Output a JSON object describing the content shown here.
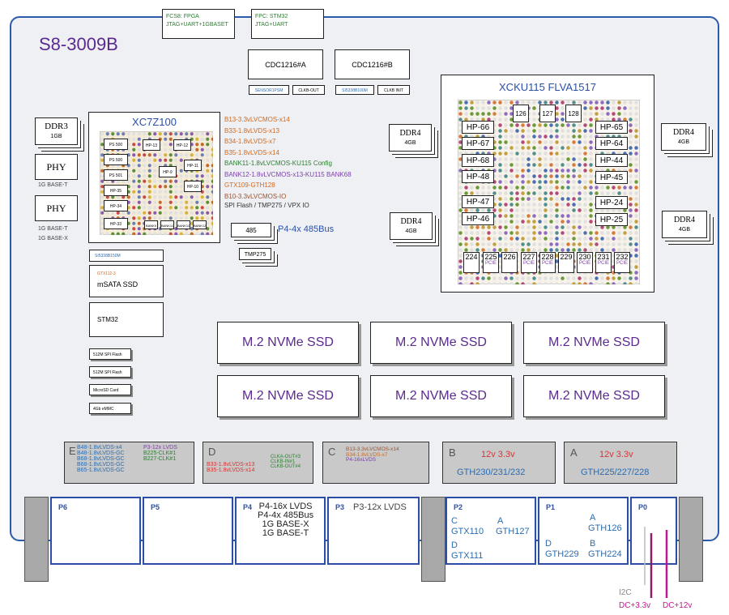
{
  "board_title": "S8-3009B",
  "top_chips": [
    {
      "line1": "FCS8: FPGA",
      "line2": "JTAG+UART+1GBASET"
    },
    {
      "line1": "FPC: STM32",
      "line2": "JTAG+UART"
    }
  ],
  "cdc": [
    {
      "label": "CDC1216#A",
      "sub": "SENSOR1PSM",
      "sub2": "CLKB-OUT"
    },
    {
      "label": "CDC1216#B",
      "sub": "SI5338B100M",
      "sub2": "CLKB INIT"
    }
  ],
  "left_parts": {
    "ddr3": {
      "label": "DDR3",
      "size": "1GB"
    },
    "phy1": {
      "label": "PHY",
      "desc": "1G BASE-T"
    },
    "phy2": {
      "label": "PHY",
      "desc1": "1G BASE-T",
      "desc2": "1G BASE-X"
    }
  },
  "zynq": {
    "label": "XC7Z100",
    "inner": [
      "PS 500",
      "PS 500",
      "PS 501",
      "HP-35",
      "HP-34",
      "HP-33",
      "HP-13",
      "HP-12",
      "HP-11",
      "HP-10",
      "HP-9",
      "BANK0",
      "BANK11",
      "BANK10",
      "BANK12"
    ]
  },
  "zynq_banks": [
    {
      "text": "B13-3.3vLVCMOS-x14",
      "color": "#d2691e"
    },
    {
      "text": "B33-1.8vLVDS-x13",
      "color": "#d2691e"
    },
    {
      "text": "B34-1.8vLVDS-x7",
      "color": "#d2691e"
    },
    {
      "text": "B35-1.8vLVDS-x14",
      "color": "#d2691e"
    },
    {
      "text": "BANK11-1.8vLVCMOS-KU115 Config",
      "color": "#2e7d32"
    },
    {
      "text": "BANK12-1.8vLVCMOS-x13-KU115 BANK68",
      "color": "#7b3fa8"
    },
    {
      "text": "GTX109-GTH128",
      "color": "#d2691e"
    },
    {
      "text": "B10-3.3vLVCMOS-IO",
      "color": "#a0522d"
    },
    {
      "text": "SPI Flash / TMP275 / VPX IO",
      "color": "#333333"
    }
  ],
  "ddr4_mid": [
    {
      "label": "DDR4",
      "size": "4GB"
    },
    {
      "label": "DDR4",
      "size": "4GB"
    }
  ],
  "bus485": {
    "chip": "485",
    "label": "P4-4x 485Bus",
    "tmp": "TMP275"
  },
  "ku115": {
    "label": "XCKU115 FLVA1517",
    "top_gt": [
      "126",
      "127",
      "128"
    ],
    "hp_left": [
      "HP-66",
      "HP-67",
      "HP-68",
      "HP-48",
      "HP-47",
      "HP-46"
    ],
    "hp_right": [
      "HP-65",
      "HP-64",
      "HP-44",
      "HP-45",
      "HP-24",
      "HP-25"
    ],
    "bottom_gt": [
      {
        "num": "224",
        "pcie": ""
      },
      {
        "num": "225",
        "pcie": "PCIE"
      },
      {
        "num": "226",
        "pcie": ""
      },
      {
        "num": "227",
        "pcie": "PCIE"
      },
      {
        "num": "228",
        "pcie": "PCIE"
      },
      {
        "num": "229",
        "pcie": ""
      },
      {
        "num": "230",
        "pcie": "PCIE"
      },
      {
        "num": "231",
        "pcie": "PCIE"
      },
      {
        "num": "232",
        "pcie": "PCIE"
      }
    ]
  },
  "ddr4_right": [
    {
      "label": "DDR4",
      "size": "4GB"
    },
    {
      "label": "DDR4",
      "size": "4GB"
    }
  ],
  "msata": {
    "top": "SI5338B150M",
    "gtx": "GTX112-3",
    "label": "mSATA SSD"
  },
  "stm32": {
    "label": "STM32"
  },
  "flash": [
    "512M SPI Flash",
    "512M SPI Flash",
    "MicroSD Card",
    "4Gb eMMC"
  ],
  "ssd_label": "M.2 NVMe SSD",
  "panel_e": {
    "letter": "E",
    "left": [
      "B48-1.8vLVDS-x4",
      "B48-1.8vLVDS-GC",
      "B68-1.8vLVDS-GC",
      "B68-1.8vLVDS-GC",
      "B65-1.8vLVDS-GC"
    ],
    "right": [
      "P3-12x LVDS",
      "B225-CLK#1",
      "B227-CLK#1"
    ]
  },
  "panel_d": {
    "letter": "D",
    "left": [
      "B33-1.8vLVDS-x13",
      "B35-1.8vLVDS-x14"
    ],
    "right": [
      "CLKA-OUT#3",
      "CLKB-IN#1",
      "CLKB-OUT#4"
    ]
  },
  "panel_c": {
    "letter": "C",
    "lines": [
      "B13-3.3vLVCMOS-x14",
      "B34-1.8vLVDS-x7",
      "P4-16xLVDS"
    ]
  },
  "panel_b": {
    "letter": "B",
    "power": "12v 3.3v",
    "gth": "GTH230/231/232"
  },
  "panel_a": {
    "letter": "A",
    "power": "12v 3.3v",
    "gth": "GTH225/227/228"
  },
  "connectors": {
    "p6": {
      "name": "P6"
    },
    "p5": {
      "name": "P5"
    },
    "p4": {
      "name": "P4",
      "lines": [
        "P4-16x LVDS",
        "P4-4x 485Bus",
        "1G BASE-X",
        "1G BASE-T"
      ]
    },
    "p3": {
      "name": "P3",
      "label": "P3-12x LVDS"
    },
    "p2": {
      "name": "P2",
      "c": "C",
      "gtx110": "GTX110",
      "a": "A",
      "gth127": "GTH127",
      "d": "D",
      "gtx111": "GTX111"
    },
    "p1": {
      "name": "P1",
      "a": "A",
      "gth126": "GTH126",
      "d": "D",
      "gth229": "GTH229",
      "b": "B",
      "gth224": "GTH224"
    },
    "p0": {
      "name": "P0"
    }
  },
  "power_labels": {
    "i2c": "I2C",
    "dc33": "DC+3.3v",
    "dc12": "DC+12v"
  }
}
